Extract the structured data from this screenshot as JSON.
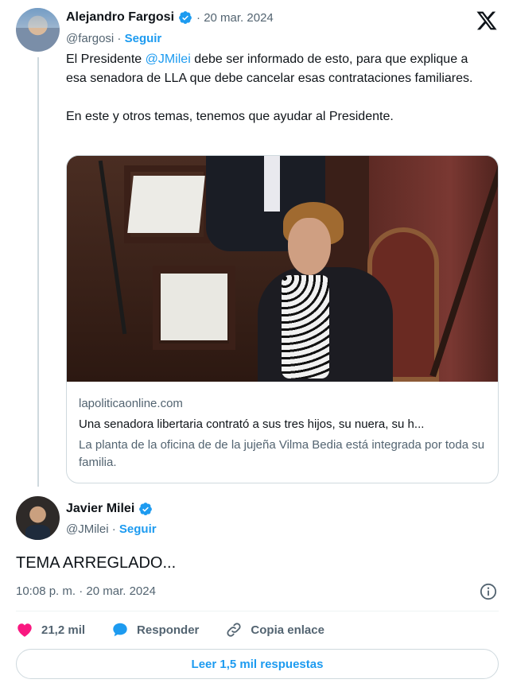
{
  "quoted_tweet": {
    "author_name": "Alejandro Fargosi",
    "date": "· 20 mar. 2024",
    "handle": "@fargosi",
    "separator": " · ",
    "follow_label": "Seguir",
    "text_pre_mention": "El Presidente ",
    "mention": "@JMilei",
    "text_post_mention": " debe ser informado de esto, para que explique a esa senadora de LLA que debe cancelar esas contrataciones familiares.",
    "text_second_paragraph": "En este y otros temas, tenemos que ayudar al Presidente.",
    "card": {
      "domain": "lapoliticaonline.com",
      "title": "Una senadora libertaria contrató a sus tres hijos, su nuera, su h...",
      "description": "La planta de la oficina de de la jujeña Vilma Bedia está integrada por toda su familia."
    }
  },
  "main_tweet": {
    "author_name": "Javier Milei",
    "handle": "@JMilei",
    "separator": " · ",
    "follow_label": "Seguir",
    "text": "TEMA ARREGLADO...",
    "timestamp": "10:08 p. m. · 20 mar. 2024"
  },
  "actions": {
    "likes": "21,2 mil",
    "reply_label": "Responder",
    "copy_link_label": "Copia enlace"
  },
  "read_replies_label": "Leer 1,5 mil respuestas",
  "colors": {
    "accent": "#1d9bf0",
    "like": "#f91880",
    "text": "#0f1419",
    "secondary": "#536471"
  },
  "icons": [
    "x-logo-icon",
    "verified-badge-icon",
    "info-icon",
    "heart-icon",
    "reply-bubble-icon",
    "link-icon"
  ]
}
